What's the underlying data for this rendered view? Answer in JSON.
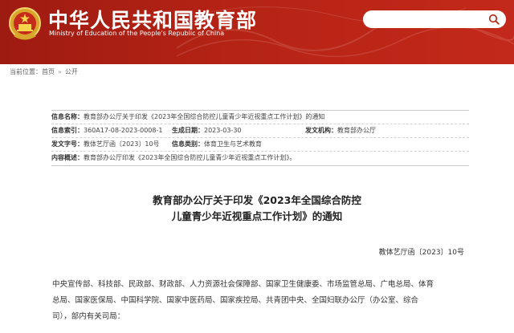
{
  "header": {
    "site_name": "中华人民共和国教育部",
    "site_name_en": "Ministry of Education of the People's Republic of China",
    "brand_color": "#b52314"
  },
  "breadcrumb": {
    "prefix": "当前位置：",
    "items": [
      "首页",
      "公开"
    ],
    "separator": "»"
  },
  "meta": {
    "info_name_label": "信息名称：",
    "info_name": "教育部办公厅关于印发《2023年全国综合防控儿童青少年近视重点工作计划》的通知",
    "index_label": "信息索引：",
    "index": "360A17-08-2023-0008-1",
    "date_label": "生成日期：",
    "date": "2023-03-30",
    "issuer_label": "发文机构：",
    "issuer": "教育部办公厅",
    "doc_no_label": "发文字号：",
    "doc_no": "教体艺厅函〔2023〕10号",
    "category_label": "信息类别：",
    "category": "体育卫生与艺术教育",
    "summary_label": "内容概述：",
    "summary": "教育部办公厅印发《2023年全国综合防控儿童青少年近视重点工作计划》。"
  },
  "article": {
    "title_line1": "教育部办公厅关于印发《2023年全国综合防控",
    "title_line2": "儿童青少年近视重点工作计划》的通知",
    "doc_number": "教体艺厅函〔2023〕10号",
    "body_line1": "中央宣传部、科技部、民政部、财政部、人力资源社会保障部、国家卫生健康委、市场监管总局、广电总局、体育",
    "body_line2": "总局、国家医保局、中国科学院、国家中医药局、国家疾控局、共青团中央、全国妇联办公厅（办公室、综合",
    "body_line3": "司），部内有关司局："
  }
}
